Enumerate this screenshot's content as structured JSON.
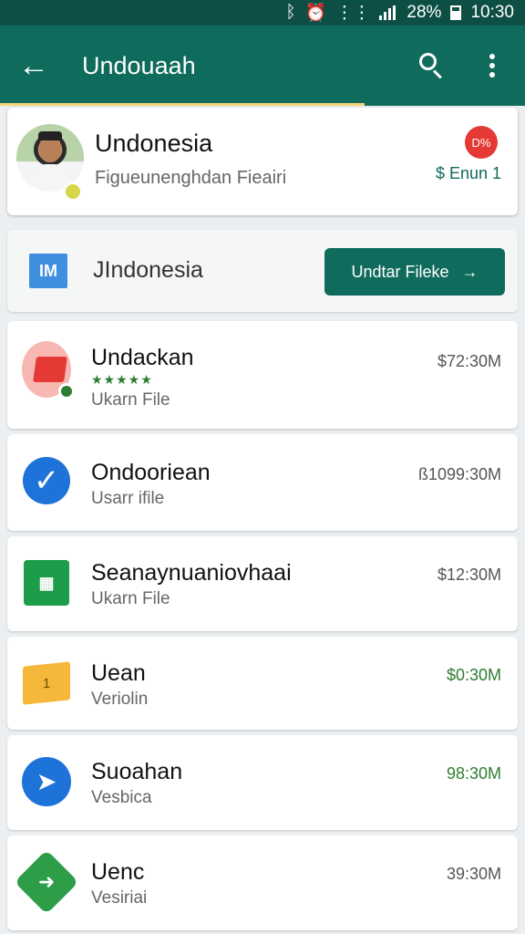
{
  "status_bar": {
    "battery_text": "28%",
    "time": "10:30",
    "icons": [
      "bluetooth-icon",
      "alarm-icon",
      "vibrate-icon",
      "signal-icon",
      "battery-icon"
    ]
  },
  "app_bar": {
    "title": "Undouaah",
    "back_icon": "arrow-left-icon",
    "search_icon": "search-icon",
    "menu_icon": "more-vert-icon",
    "accent": "#0f6b5c"
  },
  "profile": {
    "name": "Undonesia",
    "subtitle": "Figueunenghdan Fieairi",
    "badge": "D%",
    "meta": "$ Enun 1"
  },
  "country": {
    "logo_text": "IM",
    "name": "JIndonesia",
    "button_label": "Undtar Fileke",
    "button_arrow": "→"
  },
  "items": [
    {
      "title": "Undackan",
      "stars": "★★★★★",
      "subtitle": "Ukarn File",
      "price": "$72:30M",
      "icon": "red-cube-icon"
    },
    {
      "title": "Ondooriean",
      "subtitle": "Usarr ifile",
      "price": "ß1099:30M",
      "icon": "check-icon",
      "icon_text": "✓"
    },
    {
      "title": "Seanaynuaniovhaai",
      "subtitle": "Ukarn File",
      "price": "$12:30M",
      "icon": "grid-icon",
      "icon_text": "▦"
    },
    {
      "title": "Uean",
      "subtitle": "Veriolin",
      "price": "$0:30M",
      "icon": "box-icon",
      "icon_text": "1"
    },
    {
      "title": "Suoahan",
      "subtitle": "Vesbica",
      "price": "98:30M",
      "icon": "messenger-icon",
      "icon_text": "➤"
    },
    {
      "title": "Uenc",
      "subtitle": "Vesiriai",
      "price": "39:30M",
      "icon": "green-box-icon",
      "icon_text": "➜"
    }
  ]
}
